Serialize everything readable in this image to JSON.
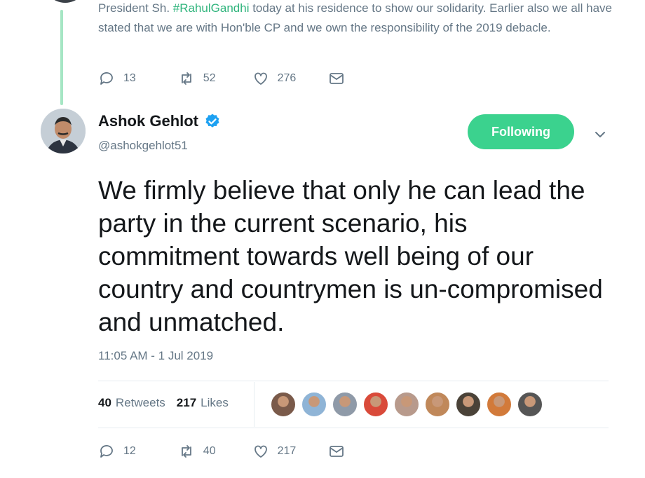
{
  "previous_tweet": {
    "text_before": "President Sh. ",
    "hashtag": "#RahulGandhi",
    "text_after": " today at his residence to show our solidarity. Earlier also we all have stated that we are with Hon'ble CP and we own the responsibility of the 2019 debacle.",
    "replies": "13",
    "retweets": "52",
    "likes": "276"
  },
  "tweet": {
    "author_name": "Ashok Gehlot",
    "handle": "@ashokgehlot51",
    "follow_label": "Following",
    "text": "We firmly believe that only he can lead the party in the current scenario, his commitment towards well being of our country and countrymen is un-compromised and unmatched.",
    "timestamp": "11:05 AM - 1 Jul 2019",
    "retweet_count": "40",
    "retweet_label": "Retweets",
    "like_count": "217",
    "like_label": "Likes",
    "replies": "12",
    "retweets": "40",
    "likes": "217"
  },
  "colors": {
    "accent_green": "#3bd28e",
    "thread_line": "#a6e6c4",
    "verified_blue": "#1da1f2",
    "muted_text": "#657786"
  },
  "likers": [
    {
      "icon": "liker-avatar-1",
      "color": "#7a5a4a"
    },
    {
      "icon": "liker-avatar-2",
      "color": "#8fb4d6"
    },
    {
      "icon": "liker-avatar-3",
      "color": "#8f9aa8"
    },
    {
      "icon": "liker-avatar-4",
      "color": "#d94a3a"
    },
    {
      "icon": "liker-avatar-5",
      "color": "#b89a8c"
    },
    {
      "icon": "liker-avatar-6",
      "color": "#c0885a"
    },
    {
      "icon": "liker-avatar-7",
      "color": "#4a4238"
    },
    {
      "icon": "liker-avatar-8",
      "color": "#d27a3a"
    },
    {
      "icon": "liker-avatar-9",
      "color": "#555555"
    }
  ]
}
